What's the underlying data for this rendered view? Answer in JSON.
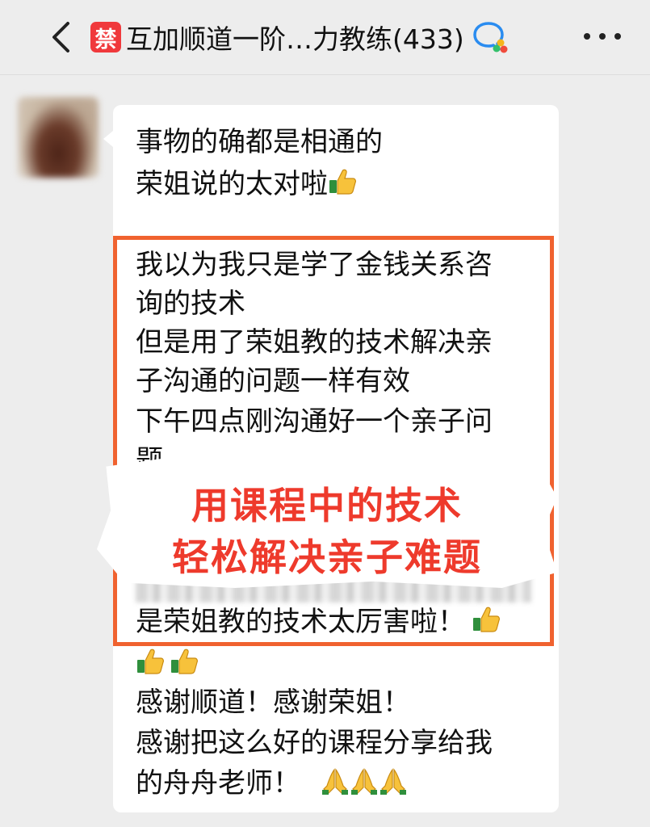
{
  "header": {
    "ban_badge": "禁",
    "title": "互加顺道一阶…力教练(433)"
  },
  "message": {
    "line1": "事物的确都是相通的",
    "line2": "荣姐说的太对啦",
    "hl1": "我以为我只是学了金钱关系咨",
    "hl2": "询的技术",
    "hl3": "但是用了荣姐教的技术解决亲",
    "hl4": "子沟通的问题一样有效",
    "hl5": "下午四点刚沟通好一个亲子问",
    "hl6": "题",
    "hl7": "是荣姐教的技术太厉害啦！",
    "line10": "感谢顺道！感谢荣姐！",
    "line11": "感谢把这么好的课程分享给我",
    "line12": "的舟舟老师！"
  },
  "overlay": {
    "banner_line1": "用课程中的技术",
    "banner_line2": "轻松解决亲子难题"
  },
  "colors": {
    "highlight_border": "#f0622f",
    "banner_text": "#ee3a2c",
    "ban_badge": "#f0393c"
  }
}
